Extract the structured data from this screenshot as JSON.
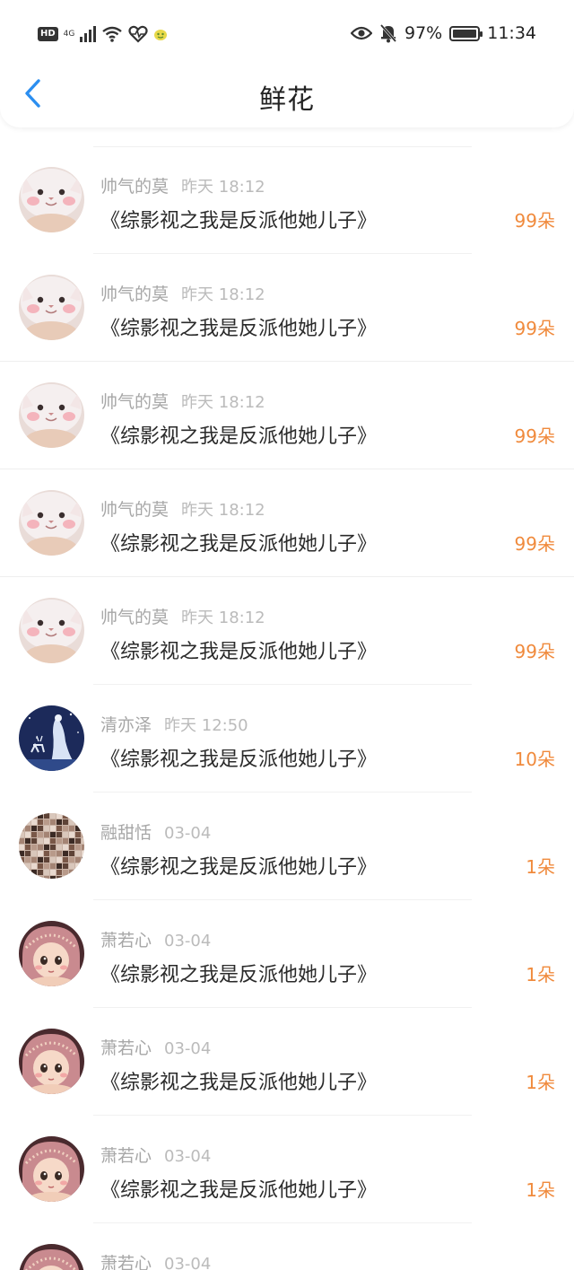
{
  "status_bar": {
    "hd": "HD",
    "network": "4G",
    "battery_percent": "97%",
    "time": "11:34"
  },
  "header": {
    "title": "鲜花"
  },
  "colors": {
    "accent_back": "#2b8ef0",
    "flower_count": "#f08a3c",
    "muted_text": "#a7a7a7"
  },
  "list": [
    {
      "user": "帅气的莫",
      "time": "昨天 18:12",
      "book": "《综影视之我是反派他她儿子》",
      "flowers": "99朵",
      "avatar": "cat"
    },
    {
      "user": "帅气的莫",
      "time": "昨天 18:12",
      "book": "《综影视之我是反派他她儿子》",
      "flowers": "99朵",
      "avatar": "cat"
    },
    {
      "user": "帅气的莫",
      "time": "昨天 18:12",
      "book": "《综影视之我是反派他她儿子》",
      "flowers": "99朵",
      "avatar": "cat"
    },
    {
      "user": "帅气的莫",
      "time": "昨天 18:12",
      "book": "《综影视之我是反派他她儿子》",
      "flowers": "99朵",
      "avatar": "cat"
    },
    {
      "user": "帅气的莫",
      "time": "昨天 18:12",
      "book": "《综影视之我是反派他她儿子》",
      "flowers": "99朵",
      "avatar": "cat"
    },
    {
      "user": "清亦泽",
      "time": "昨天 12:50",
      "book": "《综影视之我是反派他她儿子》",
      "flowers": "10朵",
      "avatar": "night"
    },
    {
      "user": "融甜恬",
      "time": "03-04",
      "book": "《综影视之我是反派他她儿子》",
      "flowers": "1朵",
      "avatar": "mosaic"
    },
    {
      "user": "萧若心",
      "time": "03-04",
      "book": "《综影视之我是反派他她儿子》",
      "flowers": "1朵",
      "avatar": "girl"
    },
    {
      "user": "萧若心",
      "time": "03-04",
      "book": "《综影视之我是反派他她儿子》",
      "flowers": "1朵",
      "avatar": "girl"
    },
    {
      "user": "萧若心",
      "time": "03-04",
      "book": "《综影视之我是反派他她儿子》",
      "flowers": "1朵",
      "avatar": "girl"
    },
    {
      "user": "萧若心",
      "time": "03-04",
      "book": "",
      "flowers": "",
      "avatar": "girl"
    }
  ]
}
